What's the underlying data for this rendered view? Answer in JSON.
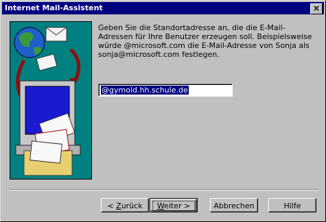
{
  "window": {
    "title": "Internet Mail-Assistent",
    "close_label": "×"
  },
  "prompt": "Geben Sie die Standortadresse an, die die E-Mail-Adressen für Ihre Benutzer erzeugen soll. Beispielsweise würde @microsoft.com die E-Mail-Adresse von Sonja als sonja@microsoft.com festlegen.",
  "address_field": {
    "value": "@gymold.hh.schule.de"
  },
  "buttons": {
    "back": {
      "pre": "< ",
      "accel": "Z",
      "rest": "urück"
    },
    "next": {
      "accel": "W",
      "rest": "eiter >"
    },
    "cancel": "Abbrechen",
    "help": "Hilfe"
  },
  "colors": {
    "titlebar": "#000080",
    "face": "#c0c0c0",
    "illustration_bg": "#008080"
  },
  "icons": [
    "close-icon",
    "globe-icon",
    "envelope-icon",
    "computer-icon",
    "mailbox-icon",
    "arrow-icon"
  ]
}
